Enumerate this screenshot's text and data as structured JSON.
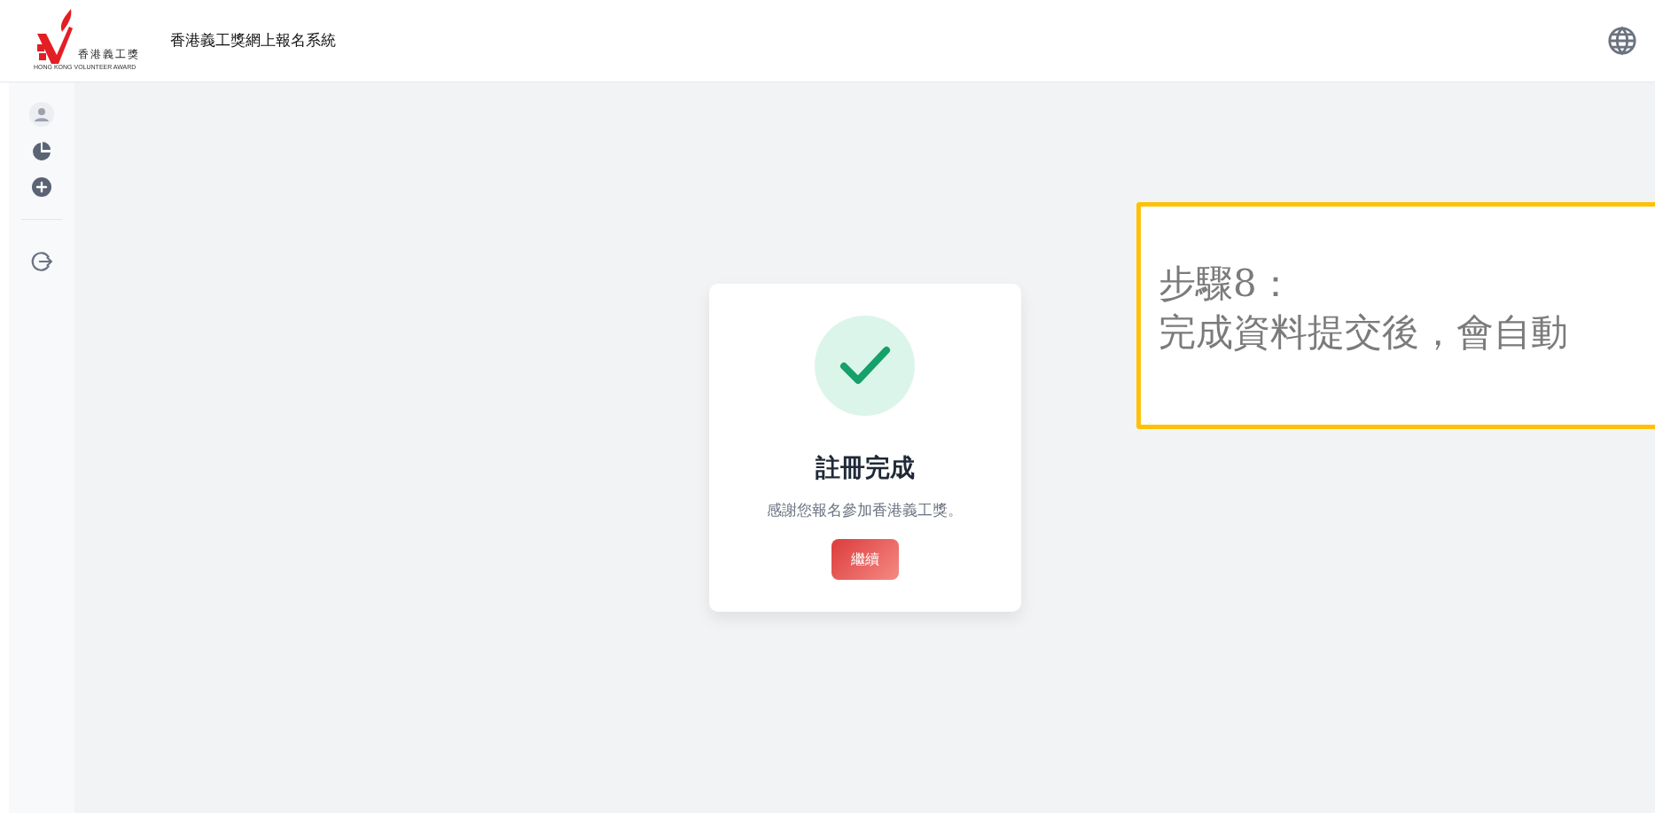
{
  "header": {
    "logo_chinese": "香港義工獎",
    "logo_english": "HONG KONG VOLUNTEER AWARD",
    "title": "香港義工獎網上報名系統"
  },
  "card": {
    "title": "註冊完成",
    "message": "感謝您報名參加香港義工獎。",
    "button": "繼續"
  },
  "callout": {
    "step": "步驟8：",
    "text": "完成資料提交後，會自動"
  }
}
